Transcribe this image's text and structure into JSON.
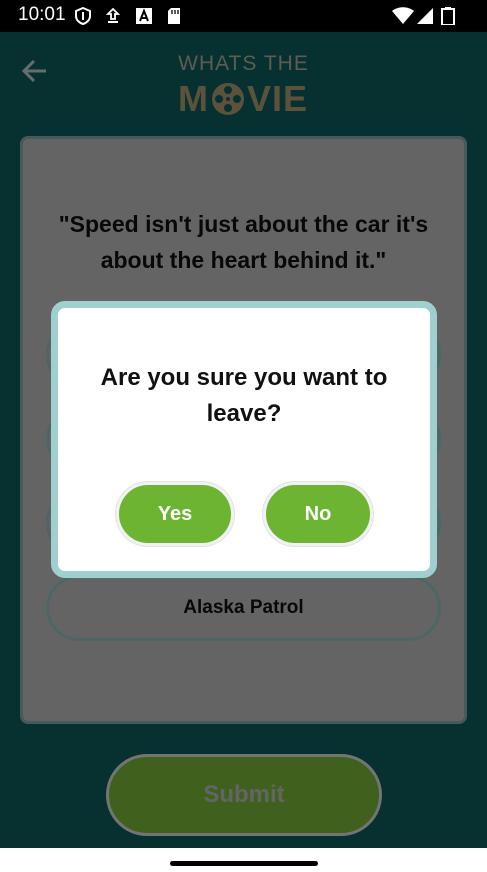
{
  "status_bar": {
    "time": "10:01",
    "left_icons": [
      "shield-icon",
      "download-icon",
      "text-a-icon",
      "sd-card-icon"
    ],
    "right_icons": [
      "wifi-icon",
      "signal-icon",
      "battery-icon"
    ]
  },
  "header": {
    "logo_top": "WHATS THE",
    "logo_bottom_left": "M",
    "logo_bottom_right": "VIE",
    "back_icon": "back-arrow-icon"
  },
  "quiz": {
    "quote": "\"Speed isn't just about the car it's about the heart behind it.\"",
    "options": [
      "",
      "",
      "",
      "Alaska Patrol"
    ],
    "submit_label": "Submit"
  },
  "dialog": {
    "title": "Are you sure you want to leave?",
    "yes_label": "Yes",
    "no_label": "No"
  },
  "colors": {
    "background": "#0e6363",
    "accent_green": "#6db433",
    "dialog_border": "#9fd0cf"
  }
}
